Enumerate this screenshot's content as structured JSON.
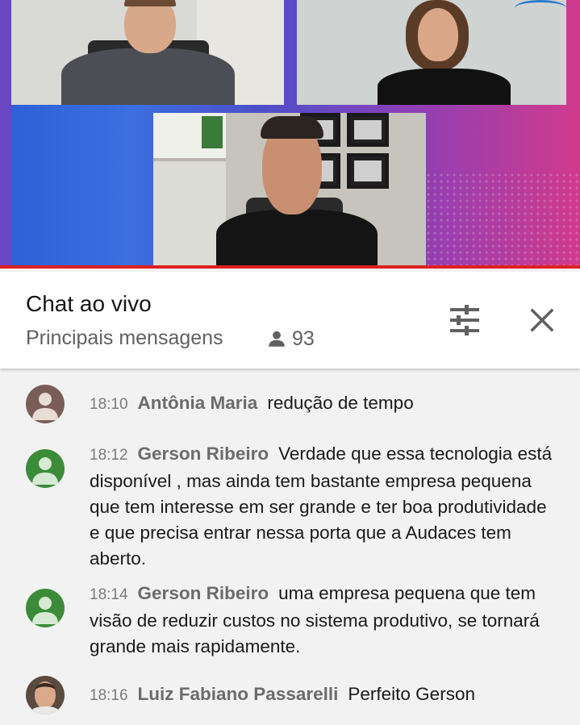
{
  "chat": {
    "title": "Chat ao vivo",
    "filter": "Principais mensagens",
    "viewer_count": "93",
    "icons": {
      "viewers": "person-icon",
      "settings": "tune-icon",
      "close": "close-icon"
    }
  },
  "messages": [
    {
      "time": "18:10",
      "author": "Antônia Maria",
      "text": "redução de tempo",
      "avatar_color": "#7b5d58"
    },
    {
      "time": "18:12",
      "author": "Gerson Ribeiro",
      "text": "Verdade que essa tecnologia está disponível , mas ainda tem bastante empresa pequena que tem interesse em ser grande e ter boa produtividade e que precisa entrar nessa porta que a Audaces tem aberto.",
      "avatar_color": "#3c8b38"
    },
    {
      "time": "18:14",
      "author": "Gerson Ribeiro",
      "text": "uma empresa pequena que tem visão de reduzir custos no sistema produtivo, se tornará grande mais rapidamente.",
      "avatar_color": "#3c8b38"
    },
    {
      "time": "18:16",
      "author": "Luiz Fabiano Passarelli",
      "text": "Perfeito Gerson",
      "avatar_color": "#8a6a55"
    }
  ],
  "colors": {
    "live_bar": "#e02020",
    "header_bg": "#ffffff",
    "chat_bg": "#f2f2f2"
  }
}
